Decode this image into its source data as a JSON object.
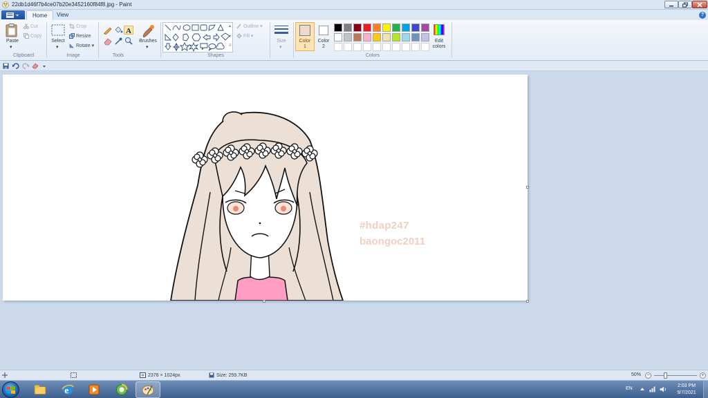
{
  "window": {
    "title": "22db1d46f7b4ce07b20e3452160f84f8.jpg - Paint",
    "app_icon": "paint-icon"
  },
  "tabs": [
    {
      "label": "Home",
      "active": true
    },
    {
      "label": "View",
      "active": false
    }
  ],
  "ribbon": {
    "clipboard": {
      "label": "Clipboard",
      "paste": "Paste",
      "cut": "Cut",
      "copy": "Copy"
    },
    "image": {
      "label": "Image",
      "select": "Select",
      "crop": "Crop",
      "resize": "Resize",
      "rotate": "Rotate"
    },
    "tools": {
      "label": "Tools",
      "brushes": "Brushes",
      "active_tool": "text-tool"
    },
    "shapes": {
      "label": "Shapes",
      "outline": "Outline",
      "fill": "Fill"
    },
    "size": {
      "label": "Size"
    },
    "colors": {
      "label": "Colors",
      "color1_label": "Color 1",
      "color1_label_line1": "Color",
      "color1_label_line2": "1",
      "color1_value": "#efd9cd",
      "color2_label_line1": "Color",
      "color2_label_line2": "2",
      "color2_value": "#ffffff",
      "edit_colors_line1": "Edit",
      "edit_colors_line2": "colors",
      "palette_row1": [
        "#000000",
        "#7f7f7f",
        "#880015",
        "#ed1c24",
        "#ff7f27",
        "#fff200",
        "#22b14c",
        "#00a2e8",
        "#3f48cc",
        "#a349a4"
      ],
      "palette_row2": [
        "#ffffff",
        "#c3c3c3",
        "#b97a57",
        "#ffaec9",
        "#ffc90e",
        "#efe4b0",
        "#b5e61d",
        "#99d9ea",
        "#7092be",
        "#c8bfe7"
      ],
      "palette_row3": [
        "#ffffff",
        "#ffffff",
        "#ffffff",
        "#ffffff",
        "#ffffff",
        "#ffffff",
        "#ffffff",
        "#ffffff",
        "#ffffff",
        "#ffffff"
      ]
    }
  },
  "canvas": {
    "watermark_line1": "#hdap247",
    "watermark_line2": "baongoc2011",
    "watermark_color": "#f1cfc1"
  },
  "statusbar": {
    "dimensions": "2376 × 1024px",
    "size": "Size: 259.7KB",
    "zoom": "50%"
  },
  "taskbar": {
    "apps": [
      "windows-explorer-icon",
      "internet-explorer-icon",
      "media-player-icon",
      "browser-icon",
      "paint-icon"
    ],
    "language": "EN",
    "time": "2:03 PM",
    "date": "9/7/2021"
  }
}
